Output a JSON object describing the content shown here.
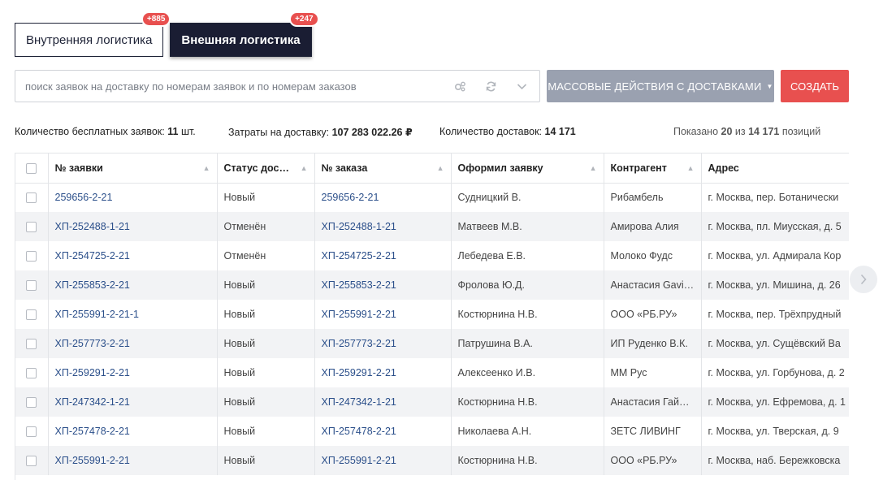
{
  "tabs": [
    {
      "label": "Внутренняя логистика",
      "badge": "+885",
      "active": false
    },
    {
      "label": "Внешняя логистика",
      "badge": "+247",
      "active": true
    }
  ],
  "search": {
    "placeholder": "поиск заявок на доставку по номерам заявок и по номерам заказов",
    "icons": [
      "settings-icon",
      "refresh-icon",
      "chevron-down-icon"
    ]
  },
  "actions": {
    "mass_label": "МАССОВЫЕ ДЕЙСТВИЯ С ДОСТАВКАМИ",
    "create_label": "СОЗДАТЬ"
  },
  "stats": {
    "free_label": "Количество бесплатных заявок:",
    "free_value": "11",
    "free_unit": "шт.",
    "cost_label": "Затраты на доставку:",
    "cost_value": "107 283 022.26 ₽",
    "count_label": "Количество доставок:",
    "count_value": "14 171",
    "shown_prefix": "Показано",
    "shown_value": "20",
    "shown_of": "из",
    "shown_total": "14 171",
    "shown_suffix": "позиций"
  },
  "table": {
    "columns": [
      "№ заявки",
      "Статус дос…",
      "№ заказа",
      "Оформил заявку",
      "Контрагент",
      "Адрес"
    ],
    "rows": [
      {
        "request": "259656-2-21",
        "status": "Новый",
        "order": "259656-2-21",
        "author": "Судницкий В.",
        "contractor": "Рибамбель",
        "address": "г. Москва, пер. Ботанически"
      },
      {
        "request": "ХП-252488-1-21",
        "status": "Отменён",
        "order": "ХП-252488-1-21",
        "author": "Матвеев М.В.",
        "contractor": "Амирова Алия",
        "address": "г. Москва, пл. Миусская, д. 5"
      },
      {
        "request": "ХП-254725-2-21",
        "status": "Отменён",
        "order": "ХП-254725-2-21",
        "author": "Лебедева Е.В.",
        "contractor": "Молоко Фудс",
        "address": "г. Москва, ул. Адмирала Кор"
      },
      {
        "request": "ХП-255853-2-21",
        "status": "Новый",
        "order": "ХП-255853-2-21",
        "author": "Фролова Ю.Д.",
        "contractor": "Анастасия Gavi…",
        "address": "г. Москва, ул. Мишина, д. 26"
      },
      {
        "request": "ХП-255991-2-21-1",
        "status": "Новый",
        "order": "ХП-255991-2-21",
        "author": "Костюрнина Н.В.",
        "contractor": "ООО «РБ.РУ»",
        "address": "г. Москва, пер. Трёхпрудный"
      },
      {
        "request": "ХП-257773-2-21",
        "status": "Новый",
        "order": "ХП-257773-2-21",
        "author": "Патрушина В.А.",
        "contractor": "ИП Руденко В.К.",
        "address": "г. Москва, ул. Сущёвский Ва"
      },
      {
        "request": "ХП-259291-2-21",
        "status": "Новый",
        "order": "ХП-259291-2-21",
        "author": "Алексеенко И.В.",
        "contractor": "ММ Рус",
        "address": "г. Москва, ул. Горбунова, д. 2"
      },
      {
        "request": "ХП-247342-1-21",
        "status": "Новый",
        "order": "ХП-247342-1-21",
        "author": "Костюрнина Н.В.",
        "contractor": "Анастасия Гай…",
        "address": "г. Москва, ул. Ефремова, д. 1"
      },
      {
        "request": "ХП-257478-2-21",
        "status": "Новый",
        "order": "ХП-257478-2-21",
        "author": "Николаева А.Н.",
        "contractor": "ЗЕТС ЛИВИНГ",
        "address": "г. Москва, ул. Тверская, д. 9"
      },
      {
        "request": "ХП-255991-2-21",
        "status": "Новый",
        "order": "ХП-255991-2-21",
        "author": "Костюрнина Н.В.",
        "contractor": "ООО «РБ.РУ»",
        "address": "г. Москва, наб. Бережковска"
      }
    ]
  },
  "pager": {
    "next_icon": "chevron-right-icon"
  },
  "colors": {
    "accent_dark": "#1a1d33",
    "danger": "#e8504f",
    "link": "#2b4f8a",
    "muted_button": "#9aa1b0"
  }
}
